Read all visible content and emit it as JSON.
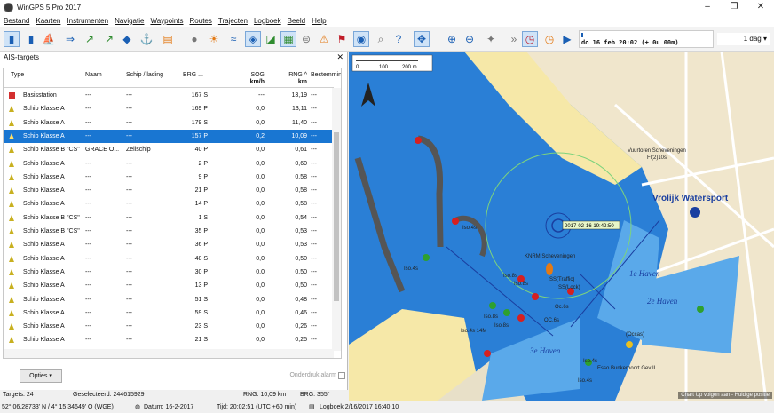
{
  "window": {
    "title": "WinGPS 5 Pro 2017"
  },
  "menu": [
    "Bestand",
    "Kaarten",
    "Instrumenten",
    "Navigatie",
    "Waypoints",
    "Routes",
    "Trajecten",
    "Logboek",
    "Beeld",
    "Help"
  ],
  "timeline": {
    "label": "do 16 feb 20:02 (+ 0u 00m)",
    "range": "1 dag"
  },
  "panel": {
    "title": "AIS-targets"
  },
  "table": {
    "headers": {
      "type": "Type",
      "name": "Naam",
      "ship": "Schip / lading",
      "brg": "BRG ...",
      "sog": "SOG",
      "sog_unit": "km/h",
      "rng": "RNG ^",
      "rng_unit": "km",
      "dest": "Bestemming"
    },
    "rows": [
      {
        "type": "Basisstation",
        "name": "---",
        "ship": "---",
        "brg": "167 S",
        "sog": "---",
        "rng": "13,19",
        "dest": "---"
      },
      {
        "type": "Schip Klasse A",
        "name": "---",
        "ship": "---",
        "brg": "169 P",
        "sog": "0,0",
        "rng": "13,11",
        "dest": "---"
      },
      {
        "type": "Schip Klasse A",
        "name": "---",
        "ship": "---",
        "brg": "179 S",
        "sog": "0,0",
        "rng": "11,40",
        "dest": "---"
      },
      {
        "type": "Schip Klasse A",
        "name": "---",
        "ship": "---",
        "brg": "157 P",
        "sog": "0,2",
        "rng": "10,09",
        "dest": "---"
      },
      {
        "type": "Schip Klasse B \"CS\"",
        "name": "GRACE O...",
        "ship": "Zeilschip",
        "brg": "40 P",
        "sog": "0,0",
        "rng": "0,61",
        "dest": "---"
      },
      {
        "type": "Schip Klasse A",
        "name": "---",
        "ship": "---",
        "brg": "2 P",
        "sog": "0,0",
        "rng": "0,60",
        "dest": "---"
      },
      {
        "type": "Schip Klasse A",
        "name": "---",
        "ship": "---",
        "brg": "9 P",
        "sog": "0,0",
        "rng": "0,58",
        "dest": "---"
      },
      {
        "type": "Schip Klasse A",
        "name": "---",
        "ship": "---",
        "brg": "21 P",
        "sog": "0,0",
        "rng": "0,58",
        "dest": "---"
      },
      {
        "type": "Schip Klasse A",
        "name": "---",
        "ship": "---",
        "brg": "14 P",
        "sog": "0,0",
        "rng": "0,58",
        "dest": "---"
      },
      {
        "type": "Schip Klasse B \"CS\"",
        "name": "---",
        "ship": "---",
        "brg": "1 S",
        "sog": "0,0",
        "rng": "0,54",
        "dest": "---"
      },
      {
        "type": "Schip Klasse B \"CS\"",
        "name": "---",
        "ship": "---",
        "brg": "35 P",
        "sog": "0,0",
        "rng": "0,53",
        "dest": "---"
      },
      {
        "type": "Schip Klasse A",
        "name": "---",
        "ship": "---",
        "brg": "36 P",
        "sog": "0,0",
        "rng": "0,53",
        "dest": "---"
      },
      {
        "type": "Schip Klasse A",
        "name": "---",
        "ship": "---",
        "brg": "48 S",
        "sog": "0,0",
        "rng": "0,50",
        "dest": "---"
      },
      {
        "type": "Schip Klasse A",
        "name": "---",
        "ship": "---",
        "brg": "30 P",
        "sog": "0,0",
        "rng": "0,50",
        "dest": "---"
      },
      {
        "type": "Schip Klasse A",
        "name": "---",
        "ship": "---",
        "brg": "13 P",
        "sog": "0,0",
        "rng": "0,50",
        "dest": "---"
      },
      {
        "type": "Schip Klasse A",
        "name": "---",
        "ship": "---",
        "brg": "51 S",
        "sog": "0,0",
        "rng": "0,48",
        "dest": "---"
      },
      {
        "type": "Schip Klasse A",
        "name": "---",
        "ship": "---",
        "brg": "59 S",
        "sog": "0,0",
        "rng": "0,46",
        "dest": "---"
      },
      {
        "type": "Schip Klasse A",
        "name": "---",
        "ship": "---",
        "brg": "23 S",
        "sog": "0,0",
        "rng": "0,26",
        "dest": "---"
      },
      {
        "type": "Schip Klasse A",
        "name": "---",
        "ship": "---",
        "brg": "21 S",
        "sog": "0,0",
        "rng": "0,25",
        "dest": "---"
      },
      {
        "type": "Schip Klasse A",
        "name": "---",
        "ship": "---",
        "brg": "17 S",
        "sog": "0,0",
        "rng": "0,24",
        "dest": "---"
      }
    ]
  },
  "buttons": {
    "options": "Opties",
    "suppress": "Onderdruk alarm"
  },
  "status": {
    "targets": "Targets: 24",
    "selected": "Geselecteerd: 244615929",
    "rng": "RNG: 10,09 km",
    "brg": "BRG: 355°",
    "position": "52° 06,28733' N / 4° 15,34649' O (WGE)",
    "datum": "Datum: 16-2-2017",
    "time": "Tijd: 20:02:51 (UTC +60 min)",
    "logbook": "Logboek 2/16/2017 16:40:10"
  },
  "map": {
    "scale": {
      "zero": "0",
      "mid": "100",
      "end": "200 m"
    },
    "labels": {
      "lighthouse": "Vuurtoren Scheveningen",
      "lighthouse_light": "Fl(2)10s",
      "watersport": "Vrolijk Watersport",
      "haven1": "1e Haven",
      "haven2": "2e Haven",
      "haven3": "3e Haven",
      "knrm": "KNRM Scheveningen",
      "target_time": "2017-02-16 19:42:50",
      "iso4_a": "Iso.4s",
      "iso4_b": "Iso.4s",
      "iso8_a": "Iso.8s",
      "iso8_b": "Iso.8s",
      "iso8_c": "Iso.8s",
      "iso4_14m": "Iso.4s 14M",
      "iso8_d": "Iso.8s",
      "oc6_a": "Oc.6s",
      "oc6_b": "OC.6s",
      "ss_traffic": "SS(Traffic)",
      "ss_lock": "SS(Lock)",
      "occas": "(Occas)",
      "esso": "Esso Bunkerpoort Gev II",
      "iso4_c": "Iso.4s",
      "iso4_d": "Iso.4s"
    },
    "footer": "Chart Up volgen aan - Huidige positie"
  },
  "colors": {
    "water": "#2a7fd6",
    "land": "#f0e6cc",
    "beach": "#f6e8a8",
    "selection": "#1976d2"
  }
}
